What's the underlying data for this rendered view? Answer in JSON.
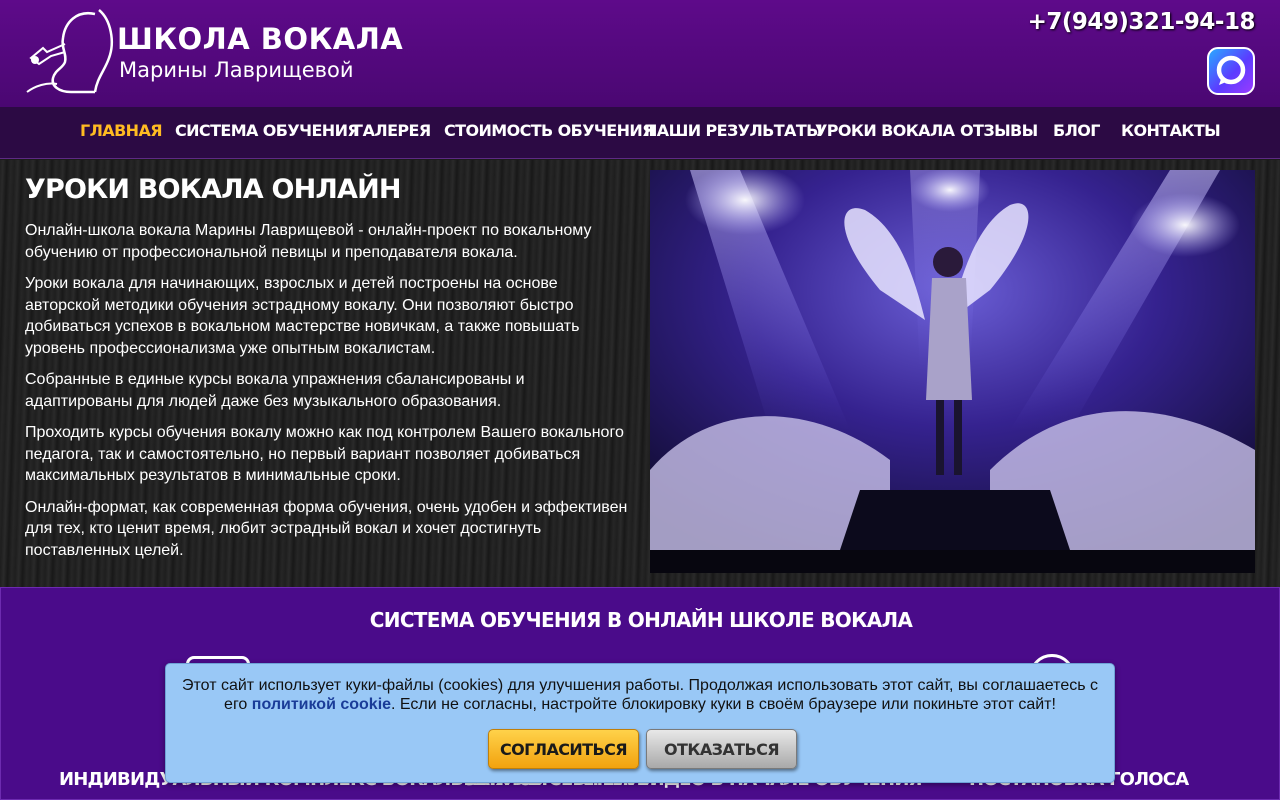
{
  "header": {
    "logo": {
      "line1": "ШКОЛА ВОКАЛА",
      "line2": "Марины Лаврищевой"
    },
    "phone": "+7(949)321-94-18",
    "messenger_icon": "messenger-icon"
  },
  "nav": {
    "items": [
      {
        "label": "ГЛАВНАЯ",
        "active": true
      },
      {
        "label": "СИСТЕМА ОБУЧЕНИЯ",
        "active": false
      },
      {
        "label": "ГАЛЕРЕЯ",
        "active": false
      },
      {
        "label": "СТОИМОСТЬ ОБУЧЕНИЯ",
        "active": false
      },
      {
        "label": "НАШИ РЕЗУЛЬТАТЫ",
        "active": false
      },
      {
        "label": "УРОКИ ВОКАЛА",
        "active": false
      },
      {
        "label": "ОТЗЫВЫ",
        "active": false
      },
      {
        "label": "БЛОГ",
        "active": false
      },
      {
        "label": "КОНТАКТЫ",
        "active": false
      }
    ],
    "active_color": "#ffbb22"
  },
  "main": {
    "title": "УРОКИ ВОКАЛА ОНЛАЙН",
    "paragraphs": [
      "Онлайн-школа вокала Марины Лаврищевой - онлайн-проект по вокальному обучению от профессиональной певицы и преподавателя вокала.",
      "Уроки вокала для начинающих, взрослых и детей построены на основе авторской методики обучения эстрадному вокалу. Они позволяют быстро добиваться успехов в вокальном мастерстве новичкам, а также повышать уровень профессионализма уже опытным вокалистам.",
      "Собранные в единые курсы вокала упражнения сбалансированы и адаптированы для людей даже без музыкального образования.",
      "Проходить курсы обучения вокалу можно как под контролем Вашего вокального педагога, так и самостоятельно, но первый вариант позволяет добиваться максимальных результатов в минимальные сроки.",
      "Онлайн-формат, как современная форма обучения, очень удобен и эффективен для тех, кто ценит время, любит эстрадный вокал и хочет достигнуть поставленных целей."
    ]
  },
  "system": {
    "title": "СИСТЕМА ОБУЧЕНИЯ В ОНЛАЙН ШКОЛЕ ВОКАЛА",
    "columns": [
      {
        "title": "ИНДИВИДУАЛЬНЫЙ КОМПЛЕКС ВОКАЛЬНЫХ УПРАЖНЕНИЙ"
      },
      {
        "title": "ЗАПИСЬ СЕБЯ НА ВИДЕО В НАЧАЛЕ ОБУЧЕНИЯ"
      },
      {
        "title": "ПОСТАНОВКА ГОЛОСА"
      }
    ]
  },
  "cookie": {
    "text_before": "Этот сайт использует куки-файлы (cookies) для улучшения работы. Продолжая использовать этот сайт, вы соглашаетесь с его ",
    "link": "политикой cookie",
    "text_after": ". Если не согласны, настройте блокировку куки в своём браузере или покиньте этот сайт!",
    "accept_label": "СОГЛАСИТЬСЯ",
    "decline_label": "ОТКАЗАТЬСЯ"
  },
  "colors": {
    "header": "#5e0a8a",
    "nav": "#2c0a44",
    "system_bg": "#4a0b8a",
    "cookie_bg": "#99c8f6",
    "accept": "#f2a20e"
  }
}
